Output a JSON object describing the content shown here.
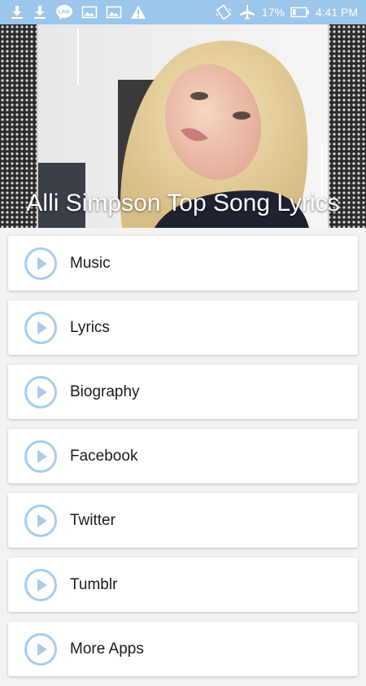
{
  "status_bar": {
    "icons": [
      "download-icon",
      "download-icon",
      "line-app-icon",
      "image-icon",
      "image-icon",
      "warning-icon",
      "vibrate-icon",
      "airplane-mode-icon",
      "battery-icon"
    ],
    "battery": "17%",
    "time": "4:41 PM"
  },
  "banner": {
    "title": "Alli Simpson Top Song Lyrics"
  },
  "menu": {
    "icon": "play-circle-icon",
    "items": [
      {
        "label": "Music"
      },
      {
        "label": "Lyrics"
      },
      {
        "label": "Biography"
      },
      {
        "label": "Facebook"
      },
      {
        "label": "Twitter"
      },
      {
        "label": "Tumblr"
      },
      {
        "label": "More Apps"
      }
    ]
  },
  "colors": {
    "status_bar": "#9cc6ea",
    "play_icon": "#a9cdec",
    "background": "#f3f3f3"
  }
}
